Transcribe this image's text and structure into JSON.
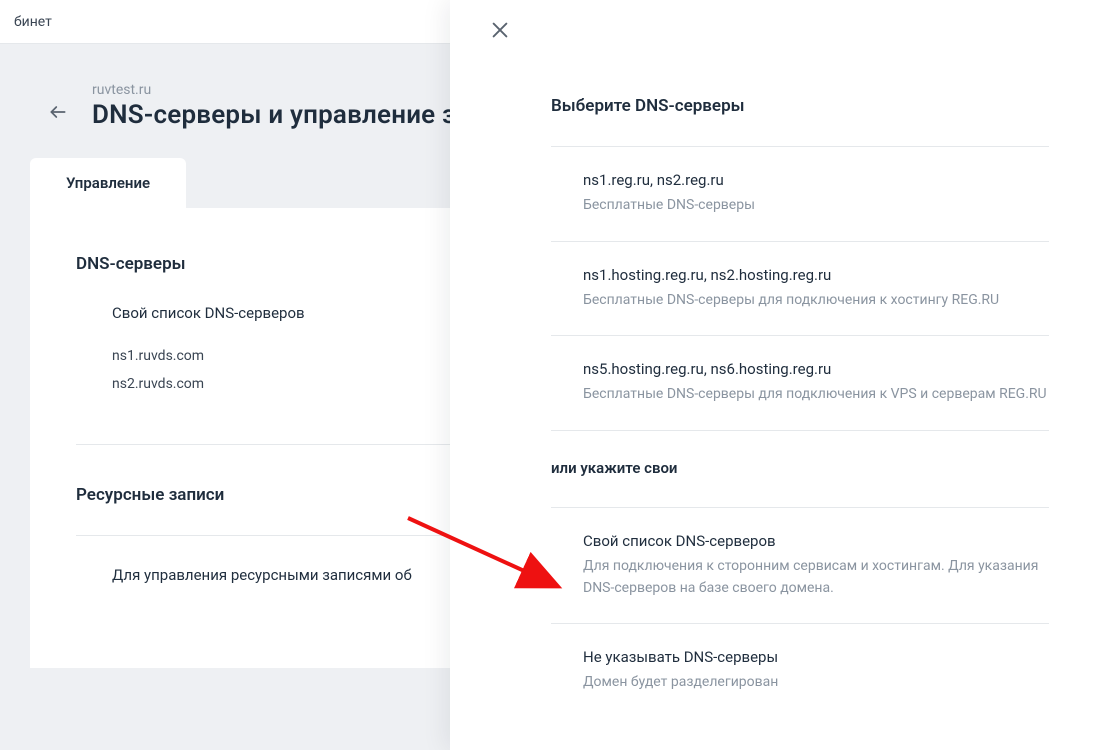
{
  "topbar": {
    "label": "бинет"
  },
  "header": {
    "domain": "ruvtest.ru",
    "title": "DNS-серверы и управление зо"
  },
  "tabs": {
    "active": "Управление"
  },
  "sections": {
    "dns": {
      "title": "DNS-серверы",
      "list_label": "Свой список DNS-серверов",
      "servers": [
        "ns1.ruvds.com",
        "ns2.ruvds.com"
      ]
    },
    "resource": {
      "title": "Ресурсные записи",
      "desc": "Для управления ресурсными записями об"
    }
  },
  "panel": {
    "title": "Выберите DNS-серверы",
    "options": [
      {
        "title": "ns1.reg.ru, ns2.reg.ru",
        "sub": "Бесплатные DNS-серверы"
      },
      {
        "title": "ns1.hosting.reg.ru, ns2.hosting.reg.ru",
        "sub": "Бесплатные DNS-серверы для подключения к хостингу REG.RU"
      },
      {
        "title": "ns5.hosting.reg.ru, ns6.hosting.reg.ru",
        "sub": "Бесплатные DNS-серверы для подключения к VPS и серверам REG.RU"
      }
    ],
    "subtitle": "или укажите свои",
    "custom_options": [
      {
        "title": "Свой список DNS-серверов",
        "sub": "Для подключения к сторонним сервисам и хостингам. Для указания DNS-серверов на базе своего домена."
      },
      {
        "title": "Не указывать DNS-серверы",
        "sub": "Домен будет разделегирован"
      }
    ]
  }
}
